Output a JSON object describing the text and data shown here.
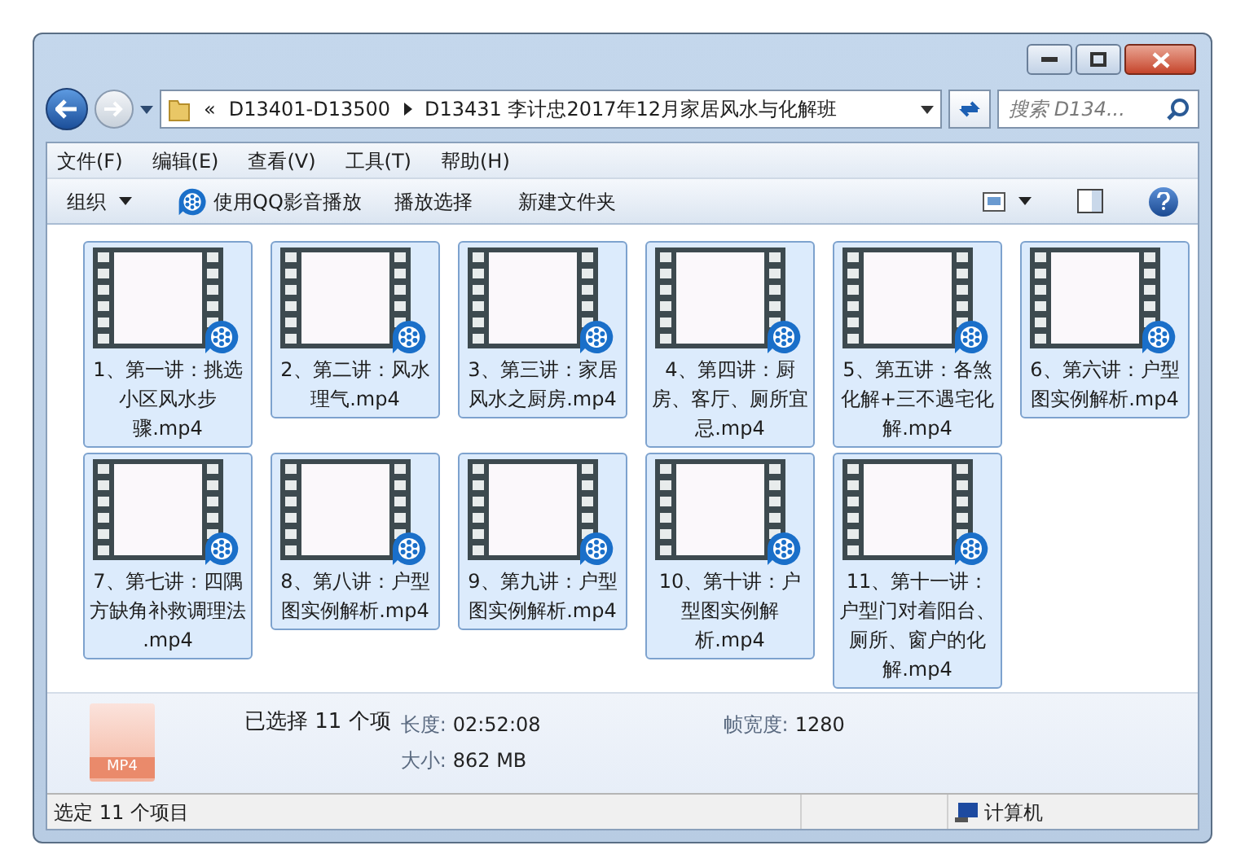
{
  "address": {
    "overflow": "«",
    "crumbs": [
      "D13401-D13500",
      "D13431 李计忠2017年12月家居风水与化解班"
    ]
  },
  "search": {
    "placeholder": "搜索 D134..."
  },
  "menu": [
    "文件(F)",
    "编辑(E)",
    "查看(V)",
    "工具(T)",
    "帮助(H)"
  ],
  "toolbar": [
    {
      "kind": "dropdown",
      "label": "组织"
    },
    {
      "kind": "player",
      "label": "使用QQ影音播放"
    },
    {
      "kind": "plain",
      "label": "播放选择"
    },
    {
      "kind": "plain",
      "label": "新建文件夹"
    }
  ],
  "files": [
    {
      "name": "1、第一讲：挑选小区风水步骤.mp4",
      "selected": true
    },
    {
      "name": "2、第二讲：风水理气.mp4",
      "selected": true
    },
    {
      "name": "3、第三讲：家居风水之厨房.mp4",
      "selected": true
    },
    {
      "name": "4、第四讲：厨房、客厅、厕所宜忌.mp4",
      "selected": true
    },
    {
      "name": "5、第五讲：各煞化解+三不遇宅化解.mp4",
      "selected": true
    },
    {
      "name": "6、第六讲：户型图实例解析.mp4",
      "selected": true
    },
    {
      "name": "7、第七讲：四隅方缺角补救调理法 .mp4",
      "selected": true
    },
    {
      "name": "8、第八讲：户型图实例解析.mp4",
      "selected": true
    },
    {
      "name": "9、第九讲：户型图实例解析.mp4",
      "selected": true
    },
    {
      "name": "10、第十讲：户型图实例解析.mp4",
      "selected": true
    },
    {
      "name": "11、第十一讲：户型门对着阳台、厕所、窗户的化解.mp4",
      "selected": true
    }
  ],
  "details": {
    "file_type": "MP4",
    "selection": "已选择 11 个项",
    "fields": [
      {
        "label": "长度:",
        "value": "02:52:08"
      },
      {
        "label": "大小:",
        "value": "862 MB"
      },
      {
        "label": "帧宽度:",
        "value": "1280"
      }
    ]
  },
  "status_bar": {
    "text": "选定 11 个项目",
    "location": "计算机"
  }
}
